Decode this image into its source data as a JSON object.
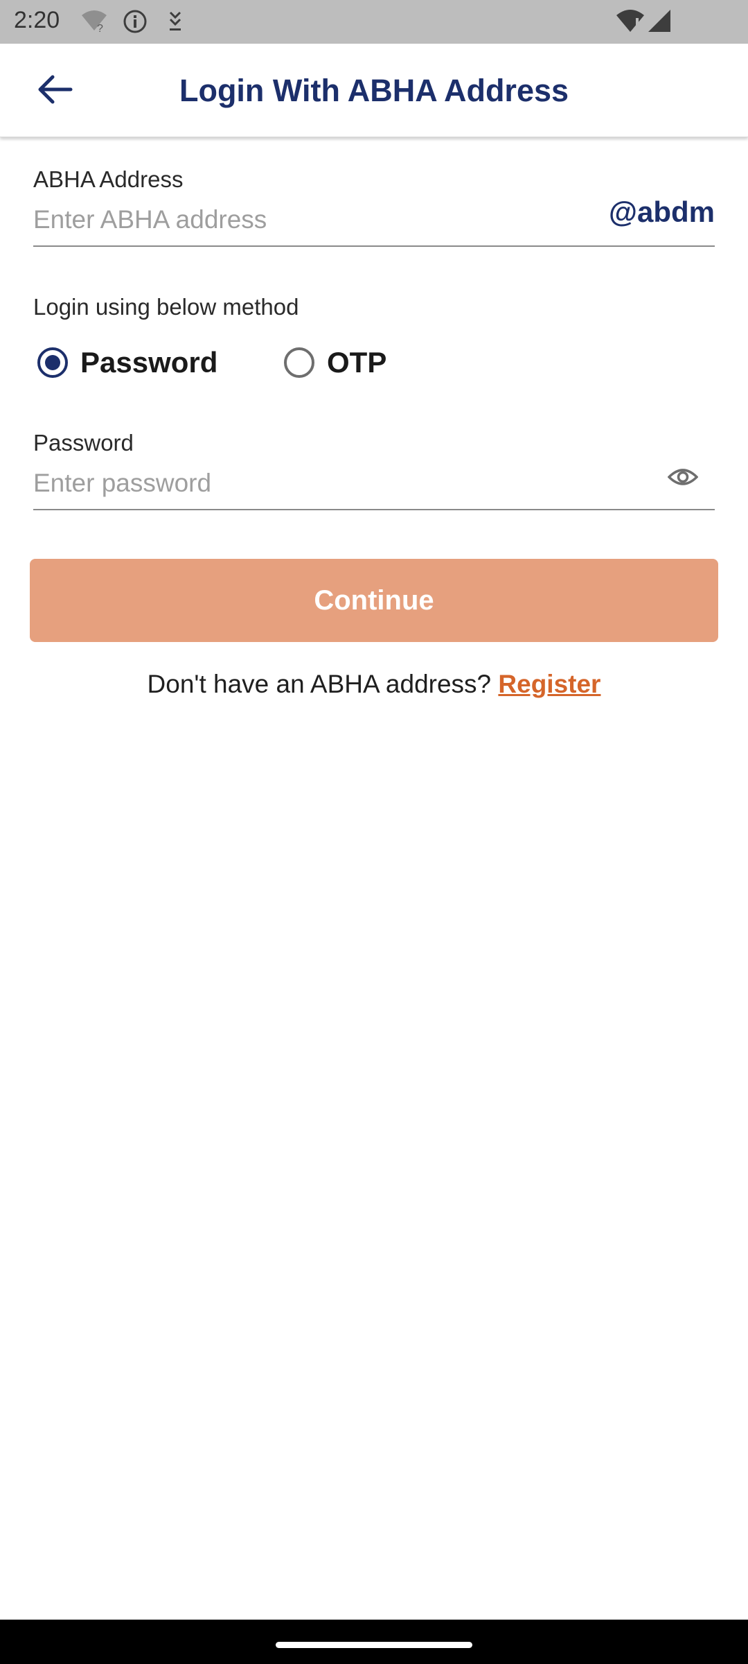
{
  "status_bar": {
    "time": "2:20",
    "icons": [
      "wifi-question-icon",
      "info-icon",
      "download-icon",
      "wifi-alert-icon",
      "cell-signal-icon"
    ]
  },
  "app_bar": {
    "title": "Login With ABHA Address",
    "back_icon": "arrow-left-icon"
  },
  "abha_field": {
    "label": "ABHA Address",
    "placeholder": "Enter ABHA address",
    "value": "",
    "suffix": "@abdm"
  },
  "login_method": {
    "label": "Login using below method",
    "options": [
      {
        "label": "Password",
        "selected": true
      },
      {
        "label": "OTP",
        "selected": false
      }
    ]
  },
  "password_field": {
    "label": "Password",
    "placeholder": "Enter password",
    "value": "",
    "toggle_icon": "eye-icon"
  },
  "continue_button": {
    "label": "Continue"
  },
  "register": {
    "prompt": "Don't have an ABHA address?",
    "link_label": "Register"
  },
  "colors": {
    "primary": "#1c2f6b",
    "button_disabled": "#e6a07e",
    "link": "#d5652a",
    "status_bar": "#bdbdbd"
  }
}
